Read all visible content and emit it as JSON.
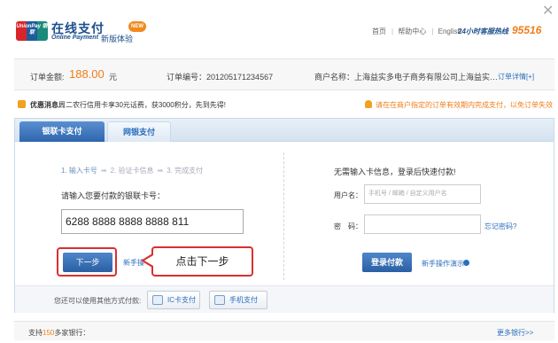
{
  "header": {
    "logo_text": "UnionPay 银联",
    "brand_cn": "在线支付",
    "brand_en": "Online Payment",
    "new_badge": "NEW",
    "edition": "新版体验",
    "links": [
      "首页",
      "帮助中心",
      "English"
    ],
    "hotline_label": "24小时客服热线",
    "hotline_number": "95516",
    "close": "✕"
  },
  "order": {
    "amount_label": "订单金额:",
    "amount": "188.00",
    "currency": "元",
    "order_id_text": "订单编号：201205171234567",
    "merchant_text": "商户名称：上海益实多电子商务有限公司上海益实…",
    "detail_link": "订单详情[+]"
  },
  "notice": {
    "label": "优惠消息:",
    "text": "周二农行信用卡享30元话费，获3000积分，先到先得!",
    "right_text": "请在在商户指定的订单有效期内完成支付，以免订单失效"
  },
  "tabs": [
    {
      "label": "银联卡支付",
      "active": true
    },
    {
      "label": "网银支付",
      "active": false
    }
  ],
  "left": {
    "steps": [
      "1. 输入卡号",
      "2. 验证卡信息",
      "3. 完成支付"
    ],
    "step_arrow": "➡",
    "prompt": "请输入您要付款的银联卡号：",
    "card_number": "6288 8888 8888 8888 811",
    "next_button": "下一步",
    "hidden_link": "新手操",
    "callout": "点击下一步"
  },
  "right": {
    "title": "无需输入卡信息，登录后快速付款!",
    "username_label": "用户名：",
    "username_placeholder": "手机号 / 邮箱 / 自定义用户名",
    "password_label": "密　码：",
    "forgot_link": "忘记密码?",
    "login_button": "登录付款",
    "demo_link": "新手操作演示"
  },
  "other": {
    "label": "您还可以使用其他方式付款:",
    "ic_button": "IC卡支付",
    "phone_button": "手机支付"
  },
  "banks": {
    "prefix": "支持",
    "count": "150",
    "suffix": "多家银行：",
    "more": "更多银行>>"
  },
  "colors": {
    "accent_orange": "#f07d1a",
    "brand_blue": "#1d4f8c",
    "link_blue": "#2a6ebd",
    "highlight_red": "#d93030"
  }
}
